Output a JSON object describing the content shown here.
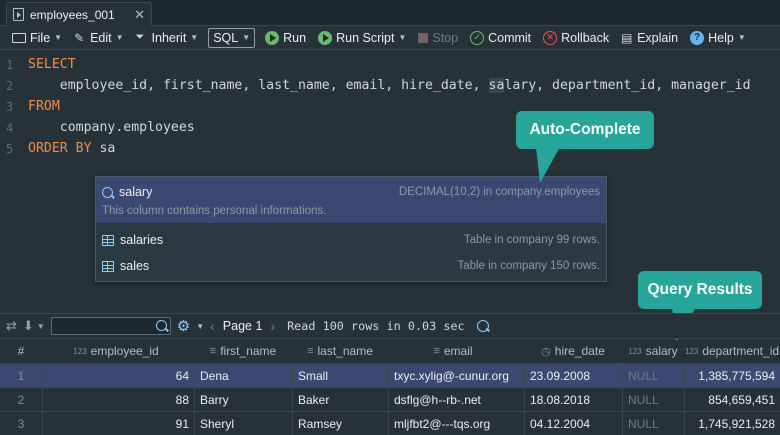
{
  "tab": {
    "label": "employees_001",
    "close": "✕"
  },
  "toolbar": {
    "file": "File",
    "edit": "Edit",
    "inherit": "Inherit",
    "sql": "SQL",
    "run": "Run",
    "run_script": "Run Script",
    "stop": "Stop",
    "commit": "Commit",
    "rollback": "Rollback",
    "explain": "Explain",
    "help": "Help"
  },
  "editor": {
    "line_numbers": [
      "1",
      "2",
      "3",
      "4",
      "5"
    ],
    "line1_kw": "SELECT",
    "line2_before": "    employee_id, first_name, last_name, email, hire_date, ",
    "line2_hl": "sa",
    "line2_after": "lary, department_id, manager_id",
    "line3_kw": "FROM",
    "line4": "    company.employees",
    "line5_kw": "ORDER BY",
    "line5_rest": " sa"
  },
  "autocomplete": {
    "items": [
      {
        "name": "salary",
        "info": "DECIMAL(10,2) in company.employees",
        "desc": "This column contains personal informations.",
        "icon": "column-search-icon"
      },
      {
        "name": "salaries",
        "info": "Table in company 99 rows.",
        "icon": "table-icon"
      },
      {
        "name": "sales",
        "info": "Table in company 150 rows.",
        "icon": "table-icon"
      }
    ]
  },
  "callouts": {
    "autocomplete": "Auto-Complete",
    "query_results": "Query Results"
  },
  "results_toolbar": {
    "page_label": "Page 1",
    "read_info": "Read 100 rows in 0.03 sec"
  },
  "grid": {
    "columns": [
      {
        "label": "#",
        "type": ""
      },
      {
        "label": "employee_id",
        "type": "123"
      },
      {
        "label": "first_name",
        "type": "≡"
      },
      {
        "label": "last_name",
        "type": "≡"
      },
      {
        "label": "email",
        "type": "≡"
      },
      {
        "label": "hire_date",
        "type": "◷"
      },
      {
        "label": "salary",
        "type": "123"
      },
      {
        "label": "department_id",
        "type": "123"
      }
    ],
    "rows": [
      [
        "1",
        "64",
        "Dena",
        "Small",
        "txyc.xylig@-cunur.org",
        "23.09.2008",
        "NULL",
        "1,385,775,594"
      ],
      [
        "2",
        "88",
        "Barry",
        "Baker",
        "dsflg@h--rb-.net",
        "18.08.2018",
        "NULL",
        "854,659,451"
      ],
      [
        "3",
        "91",
        "Sheryl",
        "Ramsey",
        "mljfbt2@---tqs.org",
        "04.12.2004",
        "NULL",
        "1,745,921,528"
      ]
    ]
  },
  "colors": {
    "background": "#263238",
    "keyword": "#f08d49",
    "selection": "#3b4872",
    "callout": "#26a69a",
    "run_green": "#66bb6a",
    "rollback_red": "#ef5350",
    "help_blue": "#64b5f6"
  }
}
